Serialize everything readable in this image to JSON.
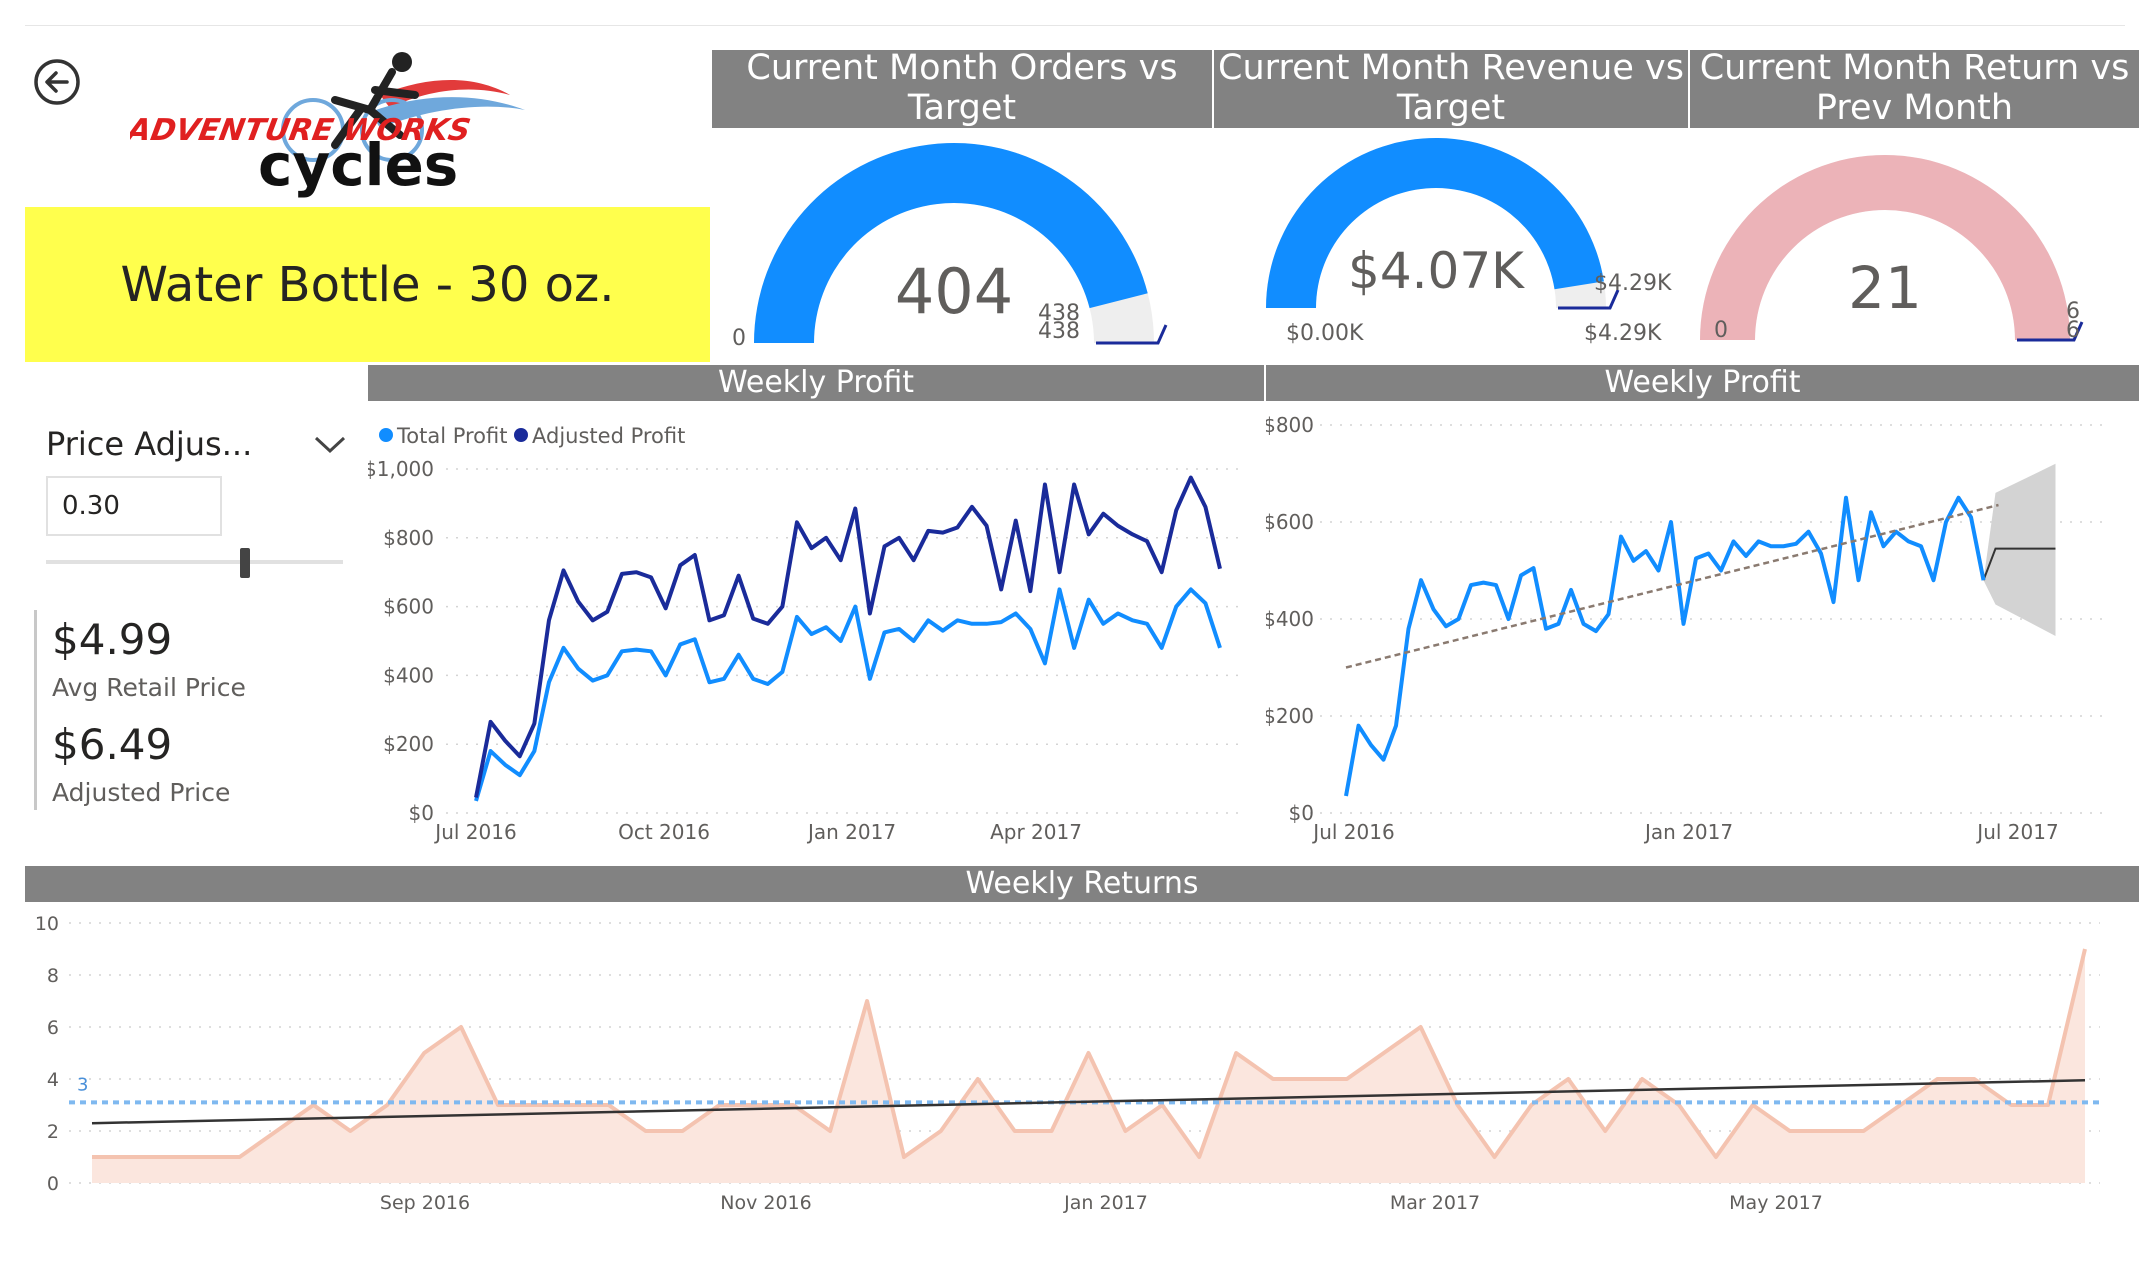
{
  "header": {
    "product": "Water Bottle - 30 oz.",
    "logo_text_1": "ADVENTURE WORKS",
    "logo_text_2": "cycles"
  },
  "gauges": [
    {
      "title_line1": "Current Month Orders vs",
      "title_line2": "Target",
      "value": 404,
      "value_label": "404",
      "min_label": "0",
      "max_label": "438",
      "target_label": "438",
      "fill_fraction": 0.92,
      "color": "#118dff"
    },
    {
      "title_line1": "Current Month Revenue vs",
      "title_line2": "Target",
      "value": 4.07,
      "value_label": "$4.07K",
      "min_label": "$0.00K",
      "max_label": "$4.29K",
      "target_label": "$4.29K",
      "fill_fraction": 0.95,
      "color": "#118dff"
    },
    {
      "title_line1": "Current Month Return vs",
      "title_line2": "Prev Month",
      "value": 21,
      "value_label": "21",
      "min_label": "0",
      "max_label": "6",
      "target_label": "6",
      "fill_fraction": 1.0,
      "color": "#ecb3b8"
    }
  ],
  "slicer": {
    "title": "Price Adjus...",
    "value": "0.30",
    "level": 0.67
  },
  "kpis": [
    {
      "value": "$4.99",
      "label": "Avg Retail Price"
    },
    {
      "value": "$6.49",
      "label": "Adjusted Price"
    }
  ],
  "chart_data": [
    {
      "type": "line",
      "title": "Weekly Profit",
      "legend_position": "top-left",
      "series": [
        {
          "name": "Total Profit",
          "color": "#118dff",
          "values": [
            35,
            180,
            140,
            110,
            180,
            380,
            480,
            420,
            385,
            400,
            470,
            475,
            470,
            400,
            490,
            505,
            380,
            390,
            460,
            390,
            375,
            410,
            570,
            520,
            540,
            500,
            600,
            390,
            525,
            535,
            500,
            560,
            530,
            560,
            550,
            550,
            555,
            580,
            535,
            435,
            650,
            480,
            620,
            550,
            580,
            560,
            550,
            480,
            600,
            650,
            610,
            480
          ]
        },
        {
          "name": "Adjusted Profit",
          "color": "#1a2b9a",
          "values": [
            45,
            265,
            210,
            165,
            260,
            560,
            705,
            615,
            560,
            585,
            695,
            700,
            685,
            595,
            720,
            750,
            560,
            575,
            690,
            565,
            550,
            600,
            845,
            770,
            800,
            735,
            885,
            580,
            775,
            800,
            735,
            820,
            815,
            830,
            890,
            835,
            650,
            850,
            645,
            955,
            700,
            955,
            810,
            870,
            835,
            810,
            790,
            700,
            880,
            975,
            890,
            710
          ]
        }
      ],
      "x_ticks": [
        "Jul 2016",
        "Oct 2016",
        "Jan 2017",
        "Apr 2017"
      ],
      "y_ticks": [
        "$0",
        "$200",
        "$400",
        "$600",
        "$800",
        "$1,000"
      ],
      "ylim": [
        0,
        1000
      ],
      "grid": true
    },
    {
      "type": "line",
      "title": "Weekly Profit",
      "series": [
        {
          "name": "Total Profit",
          "color": "#118dff",
          "values": [
            35,
            180,
            140,
            110,
            180,
            380,
            480,
            420,
            385,
            400,
            470,
            475,
            470,
            400,
            490,
            505,
            380,
            390,
            460,
            390,
            375,
            410,
            570,
            520,
            540,
            500,
            600,
            390,
            525,
            535,
            500,
            560,
            530,
            560,
            550,
            550,
            555,
            580,
            535,
            435,
            650,
            480,
            620,
            550,
            580,
            560,
            550,
            480,
            600,
            650,
            610,
            480
          ]
        },
        {
          "name": "Trend",
          "values": [
            300,
            635
          ]
        },
        {
          "name": "Forecast",
          "values": [
            545,
            545,
            545,
            545,
            545
          ]
        }
      ],
      "x_ticks": [
        "Jul 2016",
        "Jan 2017",
        "Jul 2017"
      ],
      "y_ticks": [
        "$0",
        "$200",
        "$400",
        "$600",
        "$800"
      ],
      "ylim": [
        0,
        800
      ],
      "grid": true
    },
    {
      "type": "area",
      "title": "Weekly Returns",
      "series": [
        {
          "name": "Returns",
          "color": "#f4c3b0",
          "values": [
            1,
            1,
            1,
            1,
            1,
            2,
            3,
            2,
            3,
            5,
            6,
            3,
            3,
            3,
            3,
            2,
            2,
            3,
            3,
            3,
            2,
            7,
            1,
            2,
            4,
            2,
            2,
            5,
            2,
            3,
            1,
            5,
            4,
            4,
            4,
            5,
            6,
            3,
            1,
            3,
            4,
            2,
            4,
            3,
            1,
            3,
            2,
            2,
            2,
            3,
            4,
            4,
            3,
            3,
            9
          ]
        },
        {
          "name": "Average",
          "color": "#7fb9f0",
          "values": [
            3.1
          ]
        },
        {
          "name": "Trend",
          "values": [
            2.3,
            3.95
          ]
        }
      ],
      "avg_label": "3",
      "x_ticks": [
        "Sep 2016",
        "Nov 2016",
        "Jan 2017",
        "Mar 2017",
        "May 2017"
      ],
      "y_ticks": [
        "0",
        "2",
        "4",
        "6",
        "8",
        "10"
      ],
      "ylim": [
        0,
        10
      ],
      "grid": true
    }
  ]
}
